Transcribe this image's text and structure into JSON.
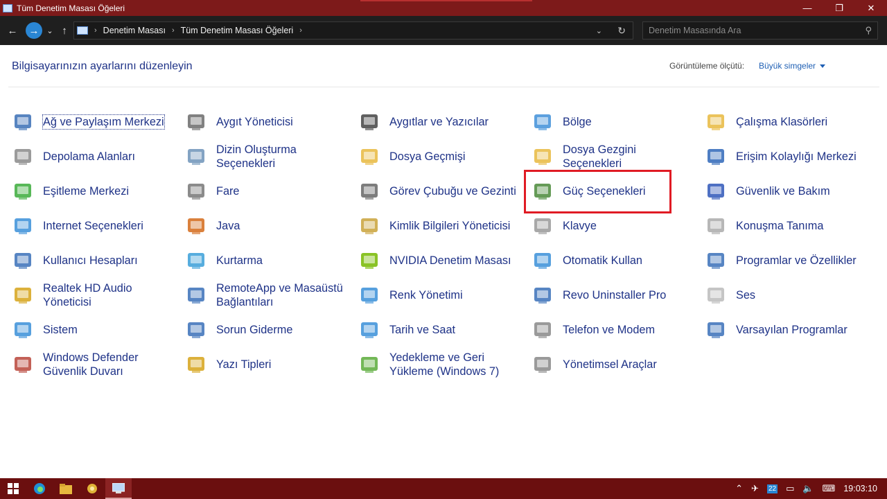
{
  "window": {
    "title": "Tüm Denetim Masası Öğeleri",
    "controls": {
      "minimize": "—",
      "restore": "❐",
      "close": "✕"
    }
  },
  "nav": {
    "back": "←",
    "forward": "→",
    "recent": "⌄",
    "up": "↑",
    "breadcrumb": [
      "Denetim Masası",
      "Tüm Denetim Masası Öğeleri"
    ],
    "search_placeholder": "Denetim Masasında Ara"
  },
  "main": {
    "heading": "Bilgisayarınızın ayarlarını düzenleyin",
    "view_by_label": "Görüntüleme ölçütü:",
    "view_by_value": "Büyük simgeler",
    "items": [
      {
        "label": "Ağ ve Paylaşım Merkezi",
        "icon": "network-icon"
      },
      {
        "label": "Aygıt Yöneticisi",
        "icon": "device-manager-icon"
      },
      {
        "label": "Aygıtlar ve Yazıcılar",
        "icon": "printer-icon"
      },
      {
        "label": "Bölge",
        "icon": "globe-clock-icon"
      },
      {
        "label": "Çalışma Klasörleri",
        "icon": "work-folders-icon"
      },
      {
        "label": "Depolama Alanları",
        "icon": "storage-icon"
      },
      {
        "label": "Dizin Oluşturma Seçenekleri",
        "icon": "indexing-icon"
      },
      {
        "label": "Dosya Geçmişi",
        "icon": "file-history-icon"
      },
      {
        "label": "Dosya Gezgini Seçenekleri",
        "icon": "folder-options-icon"
      },
      {
        "label": "Erişim Kolaylığı Merkezi",
        "icon": "accessibility-icon"
      },
      {
        "label": "Eşitleme Merkezi",
        "icon": "sync-icon"
      },
      {
        "label": "Fare",
        "icon": "mouse-icon"
      },
      {
        "label": "Görev Çubuğu ve Gezinti",
        "icon": "taskbar-icon"
      },
      {
        "label": "Güç Seçenekleri",
        "icon": "power-options-icon"
      },
      {
        "label": "Güvenlik ve Bakım",
        "icon": "flag-icon"
      },
      {
        "label": "Internet Seçenekleri",
        "icon": "internet-options-icon"
      },
      {
        "label": "Java",
        "icon": "java-icon"
      },
      {
        "label": "Kimlik Bilgileri Yöneticisi",
        "icon": "credential-icon"
      },
      {
        "label": "Klavye",
        "icon": "keyboard-icon"
      },
      {
        "label": "Konuşma Tanıma",
        "icon": "microphone-icon"
      },
      {
        "label": "Kullanıcı Hesapları",
        "icon": "users-icon"
      },
      {
        "label": "Kurtarma",
        "icon": "recovery-icon"
      },
      {
        "label": "NVIDIA Denetim Masası",
        "icon": "nvidia-icon"
      },
      {
        "label": "Otomatik Kullan",
        "icon": "autoplay-icon"
      },
      {
        "label": "Programlar ve Özellikler",
        "icon": "programs-icon"
      },
      {
        "label": "Realtek HD Audio Yöneticisi",
        "icon": "realtek-icon"
      },
      {
        "label": "RemoteApp ve Masaüstü Bağlantıları",
        "icon": "remoteapp-icon"
      },
      {
        "label": "Renk Yönetimi",
        "icon": "color-management-icon"
      },
      {
        "label": "Revo Uninstaller Pro",
        "icon": "revo-icon"
      },
      {
        "label": "Ses",
        "icon": "speaker-icon"
      },
      {
        "label": "Sistem",
        "icon": "system-icon"
      },
      {
        "label": "Sorun Giderme",
        "icon": "troubleshoot-icon"
      },
      {
        "label": "Tarih ve Saat",
        "icon": "calendar-icon"
      },
      {
        "label": "Telefon ve Modem",
        "icon": "phone-icon"
      },
      {
        "label": "Varsayılan Programlar",
        "icon": "default-programs-icon"
      },
      {
        "label": "Windows Defender Güvenlik Duvarı",
        "icon": "firewall-icon"
      },
      {
        "label": "Yazı Tipleri",
        "icon": "fonts-icon"
      },
      {
        "label": "Yedekleme ve Geri Yükleme (Windows 7)",
        "icon": "backup-icon"
      },
      {
        "label": "Yönetimsel Araçlar",
        "icon": "admin-tools-icon"
      }
    ]
  },
  "taskbar": {
    "tray_badge": "22",
    "clock": "19:03:10"
  },
  "colors": {
    "titlebar": "#7d1a1a",
    "taskbar": "#6b0f0f",
    "link": "#1e3287",
    "highlight": "#e01b24"
  }
}
